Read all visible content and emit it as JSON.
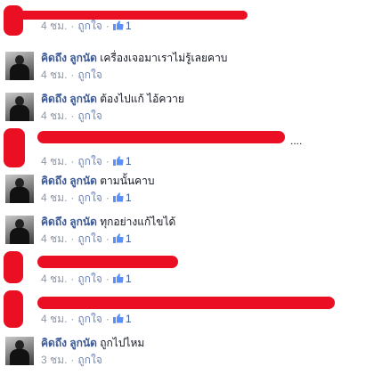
{
  "colors": {
    "name": "#3b5998",
    "meta": "#9197a3",
    "redaction": "#ea0f22"
  },
  "comments": [
    {
      "author": "",
      "text": "",
      "time": "4 ชม.",
      "like_label": "ถูกใจ",
      "likes": "1",
      "redacted": true
    },
    {
      "author": "คิดถึง ลูกนัด",
      "text": "เครื่องเจอมาเราไม่รู้เลยคาบ",
      "time": "4 ชม.",
      "like_label": "ถูกใจ",
      "likes": "",
      "redacted": false
    },
    {
      "author": "คิดถึง ลูกนัด",
      "text": "ต้องไปแก้ ไอ้ควาย",
      "time": "4 ชม.",
      "like_label": "ถูกใจ",
      "likes": "",
      "redacted": false
    },
    {
      "author": "",
      "text": "....",
      "time": "4 ชม.",
      "like_label": "ถูกใจ",
      "likes": "1",
      "redacted": true
    },
    {
      "author": "คิดถึง ลูกนัด",
      "text": "ตามนั้นคาบ",
      "time": "4 ชม.",
      "like_label": "ถูกใจ",
      "likes": "1",
      "redacted": false
    },
    {
      "author": "คิดถึง ลูกนัด",
      "text": "ทุกอย่างแก้ไขได้",
      "time": "4 ชม.",
      "like_label": "ถูกใจ",
      "likes": "1",
      "redacted": false
    },
    {
      "author": "",
      "text": "",
      "time": "4 ชม.",
      "like_label": "ถูกใจ",
      "likes": "1",
      "redacted": true
    },
    {
      "author": "",
      "text": "",
      "time": "4 ชม.",
      "like_label": "ถูกใจ",
      "likes": "1",
      "redacted": true
    },
    {
      "author": "คิดถึง ลูกนัด",
      "text": "ถูกไปไหม",
      "time": "3 ชม.",
      "like_label": "ถูกใจ",
      "likes": "",
      "redacted": false
    }
  ]
}
